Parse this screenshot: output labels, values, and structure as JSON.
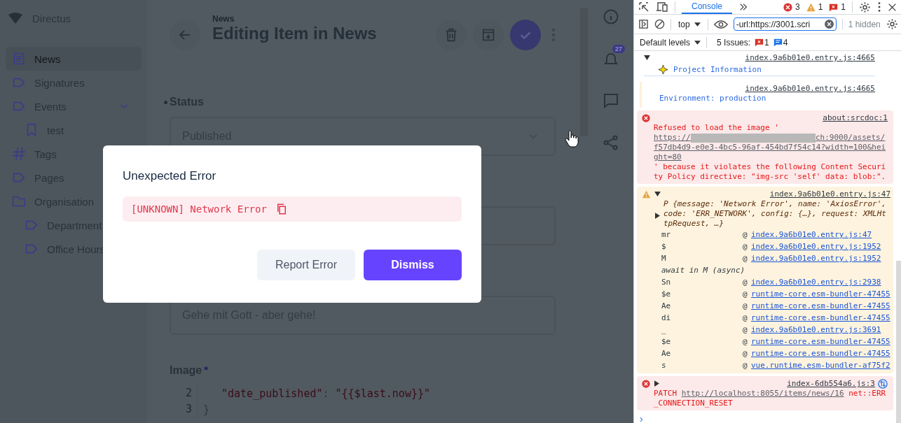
{
  "app": {
    "brand": "Directus",
    "sidebar": [
      {
        "label": "News",
        "kind": "document",
        "selected": true
      },
      {
        "label": "Signatures",
        "kind": "tag",
        "selected": false
      },
      {
        "label": "Events",
        "kind": "tag",
        "selected": false,
        "expanded": true,
        "children": [
          {
            "label": "test",
            "kind": "bookmark",
            "selected": false
          }
        ]
      },
      {
        "label": "Tags",
        "kind": "hash",
        "selected": false
      },
      {
        "label": "Pages",
        "kind": "tag",
        "selected": false
      },
      {
        "label": "Organisation",
        "kind": "folder",
        "selected": false,
        "children": [
          {
            "label": "Department",
            "kind": "tag",
            "selected": false
          },
          {
            "label": "Office Hours",
            "kind": "tag",
            "selected": false
          }
        ]
      }
    ],
    "header": {
      "breadcrumb": "News",
      "title": "Editing Item in News"
    },
    "notifications_badge": "27",
    "fields": [
      {
        "kind": "select",
        "label": "Status",
        "edited": true,
        "value": "Published"
      },
      {
        "kind": "input"
      },
      {
        "kind": "input",
        "value": "Gehe mit Gott - aber gehe!"
      },
      {
        "kind": "code",
        "label": "Image",
        "edited": false,
        "required_mark": "*",
        "lines": [
          {
            "number": "2",
            "key": "\"date_published\"",
            "sep": ":",
            "value": "\"{{$last.now}}\""
          },
          {
            "number": "3",
            "text": "}"
          }
        ]
      }
    ]
  },
  "dialog": {
    "title": "Unexpected Error",
    "error": "[UNKNOWN] Network Error",
    "buttons": [
      {
        "label": "Report Error",
        "kind": "secondary"
      },
      {
        "label": "Dismiss",
        "kind": "primary"
      }
    ]
  },
  "devtools": {
    "tabs": [
      {
        "label": "Console",
        "selected": true
      }
    ],
    "counts": {
      "errors": "3",
      "warnings": "1",
      "issues": "1"
    },
    "context": "top",
    "filter": "-url:https://3001.scri",
    "hidden": "1 hidden",
    "levels": "Default levels",
    "issues_label": "5 Issues:",
    "issue_counts": {
      "errors": "1",
      "info": "4"
    },
    "entries": [
      {
        "kind": "group",
        "expanded": true,
        "source": "index.9a6b01e0.entry.js:4665",
        "text": "Project Information"
      },
      {
        "kind": "log",
        "source": "index.9a6b01e0.entry.js:4665",
        "text": "Environment: production"
      },
      {
        "kind": "error",
        "source": "about:srcdoc:1",
        "text": "Refused to load the image '",
        "url_start": "https://",
        "url_redacted": true,
        "url_end": "ch:9000/assets/f57db4d9-e0e3-4bc5-96af-454bd7f54c14?width=100&height=80",
        "text_after": "' because it violates the following Content Security Policy directive: \"img-src 'self' data: blob:\"."
      },
      {
        "kind": "warning",
        "expanded": true,
        "source": "index.9a6b01e0.entry.js:47",
        "object": "P {message: 'Network Error', name: 'AxiosError', code: 'ERR_NETWORK', config: {…}, request: XMLHttpRequest, …}",
        "object_expanded": false,
        "stack": [
          {
            "kind": "frame",
            "fn": "mr",
            "at": "@",
            "link": "index.9a6b01e0.entry.js:47"
          },
          {
            "kind": "frame",
            "fn": "$",
            "at": "@",
            "link": "index.9a6b01e0.entry.js:1952"
          },
          {
            "kind": "frame",
            "fn": "M",
            "at": "@",
            "link": "index.9a6b01e0.entry.js:1952"
          },
          {
            "kind": "async",
            "note": "await in M (async)"
          },
          {
            "kind": "frame",
            "fn": "Sn",
            "at": "@",
            "link": "index.9a6b01e0.entry.js:2938"
          },
          {
            "kind": "frame",
            "fn": "$e",
            "at": "@",
            "link": "runtime-core.esm-bundler-47455"
          },
          {
            "kind": "frame",
            "fn": "Ae",
            "at": "@",
            "link": "runtime-core.esm-bundler-47455"
          },
          {
            "kind": "frame",
            "fn": "di",
            "at": "@",
            "link": "runtime-core.esm-bundler-47455"
          },
          {
            "kind": "frame",
            "fn": "_",
            "at": "@",
            "link": "index.9a6b01e0.entry.js:3691"
          },
          {
            "kind": "frame",
            "fn": "$e",
            "at": "@",
            "link": "runtime-core.esm-bundler-47455"
          },
          {
            "kind": "frame",
            "fn": "Ae",
            "at": "@",
            "link": "runtime-core.esm-bundler-47455"
          },
          {
            "kind": "frame",
            "fn": "s",
            "at": "@",
            "link": "vue.runtime.esm-bundler-af75f2"
          }
        ]
      },
      {
        "kind": "network",
        "expanded": false,
        "method": "PATCH",
        "url": "http://localhost:8055/items/news/16",
        "message": "net::ERR_CONNECTION_RESET",
        "source": "index-6db554a6.js:3"
      }
    ],
    "prompt": "›"
  }
}
